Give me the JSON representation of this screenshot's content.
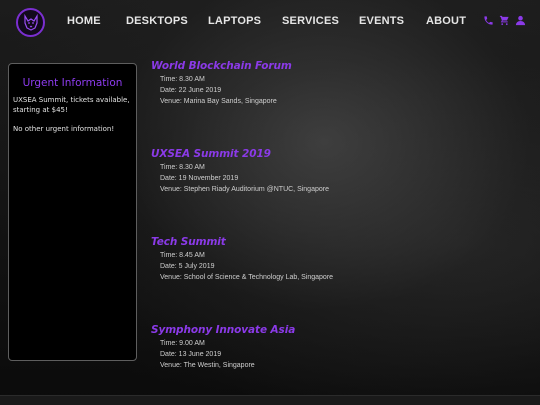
{
  "nav": {
    "links": [
      "HOME",
      "DESKTOPS",
      "LAPTOPS",
      "SERVICES",
      "EVENTS",
      "ABOUT"
    ],
    "icons": [
      "phone-icon",
      "cart-icon",
      "user-icon"
    ],
    "accent_color": "#8b3ae8"
  },
  "sidebar": {
    "title": "Urgent Information",
    "messages": [
      "UXSEA Summit, tickets available, starting at $45!",
      "No other urgent information!"
    ]
  },
  "events": [
    {
      "title": "World Blockchain Forum",
      "time": "Time: 8.30 AM",
      "date": "Date: 22 June 2019",
      "venue": "Venue: Marina Bay Sands, Singapore"
    },
    {
      "title": "UXSEA Summit 2019",
      "time": "Time: 8.30 AM",
      "date": "Date: 19 November 2019",
      "venue": "Venue: Stephen Riady Auditorium @NTUC, Singapore"
    },
    {
      "title": "Tech Summit",
      "time": "Time: 8.45 AM",
      "date": "Date: 5 July 2019",
      "venue": "Venue: School of Science & Technology Lab, Singapore"
    },
    {
      "title": "Symphony Innovate Asia",
      "time": "Time: 9.00 AM",
      "date": "Date: 13 June 2019",
      "venue": "Venue: The Westin, Singapore"
    }
  ]
}
